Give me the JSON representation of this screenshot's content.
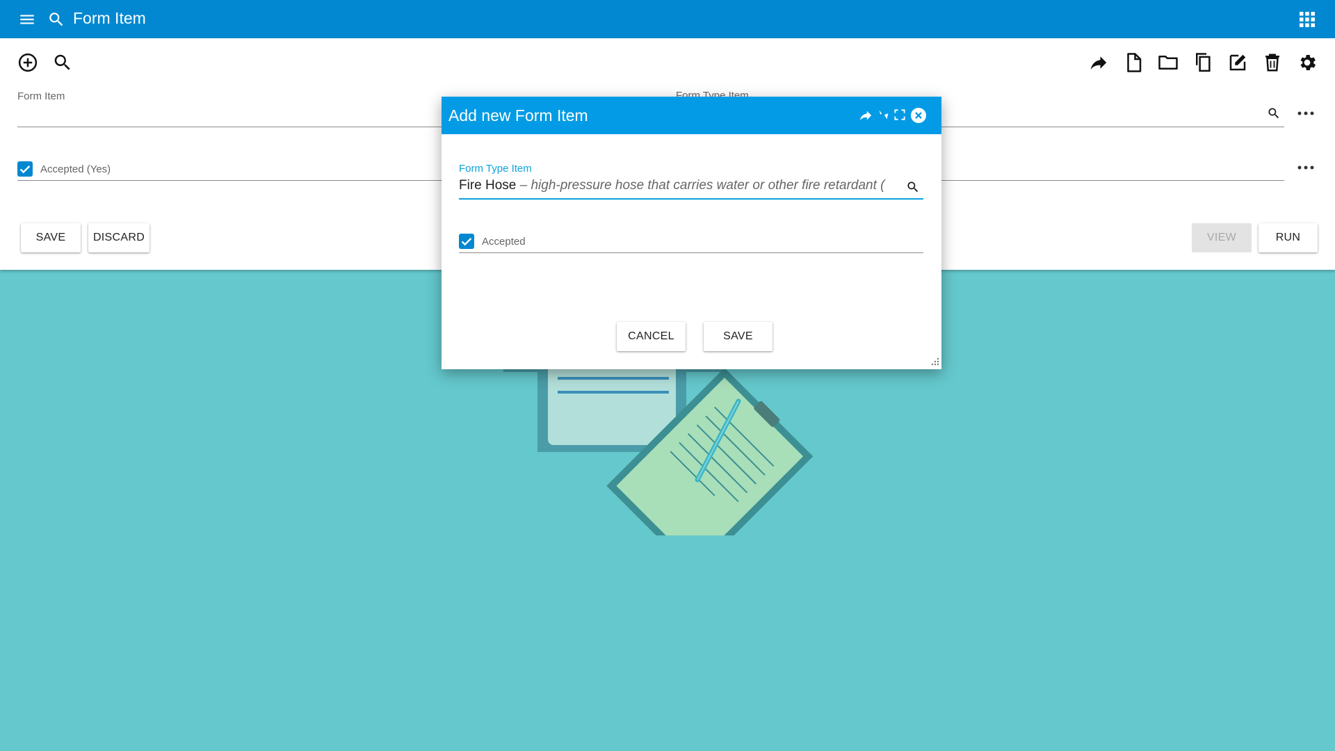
{
  "appbar": {
    "title": "Form Item",
    "menu_icon": "menu-icon",
    "search_icon": "search-icon",
    "apps_icon": "apps-grid-icon",
    "color": "#0288d1"
  },
  "toolbar": {
    "left_icons": [
      "add-circle-icon",
      "search-icon"
    ],
    "right_icons": [
      "share-icon",
      "new-document-icon",
      "folder-icon",
      "copy-icon",
      "edit-icon",
      "delete-icon",
      "settings-icon"
    ]
  },
  "form": {
    "form_item_label": "Form Item",
    "form_type_item_label": "Form Type Item",
    "accepted_label": "Accepted (Yes)",
    "accepted_checked": true
  },
  "actions": {
    "save": "SAVE",
    "discard": "DISCARD",
    "view": "VIEW",
    "run": "RUN"
  },
  "dialog": {
    "title": "Add new Form Item",
    "field_label": "Form Type Item",
    "field_value_name": "Fire Hose",
    "field_value_separator": " – ",
    "field_value_description": "high-pressure hose that carries water or other fire retardant (",
    "accepted_label": "Accepted",
    "accepted_checked": true,
    "cancel": "CANCEL",
    "save": "SAVE",
    "header_color": "#039be5"
  },
  "background_color": "#64c8cc"
}
